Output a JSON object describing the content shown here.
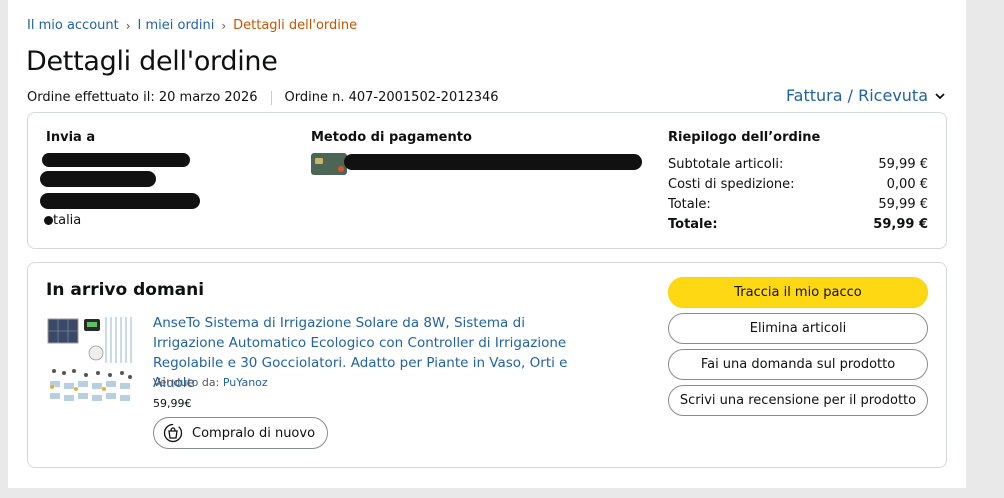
{
  "breadcrumb": {
    "account": "Il mio account",
    "orders": "I miei ordini",
    "current": "Dettagli dell'ordine",
    "separator": "›"
  },
  "page_title": "Dettagli dell'ordine",
  "order_meta": {
    "placed": "Ordine effettuato il: 20 marzo 2026",
    "number": "Ordine n. 407-2001502-2012346"
  },
  "invoice_label": "Fattura / Ricevuta",
  "shipping": {
    "title": "Invia a",
    "country": "talia"
  },
  "payment": {
    "title": "Metodo di pagamento"
  },
  "summary": {
    "title": "Riepilogo dell’ordine",
    "rows": [
      {
        "label": "Subtotale articoli:",
        "value": "59,99 €"
      },
      {
        "label": "Costi di spedizione:",
        "value": "0,00 €"
      },
      {
        "label": "Totale:",
        "value": "59,99 €"
      },
      {
        "label": "Totale:",
        "value": "59,99 €"
      }
    ]
  },
  "delivery": {
    "status": "In arrivo domani",
    "product_title": "AnseTo Sistema di Irrigazione Solare da 8W, Sistema di Irrigazione Automatico Ecologico con Controller di Irrigazione Regolabile e 30 Gocciolatori. Adatto per Piante in Vaso, Orti e Aiuole",
    "sold_by_label": "Venduto da:",
    "seller": "PuYanoz",
    "price": "59,99€",
    "buy_again": "Compralo di nuovo"
  },
  "actions": {
    "track": "Traccia il mio pacco",
    "remove": "Elimina articoli",
    "ask": "Fai una domanda sul prodotto",
    "review": "Scrivi una recensione per il prodotto"
  },
  "colors": {
    "link": "#2162a1",
    "breadcrumb_current": "#c45500",
    "primary_button": "#ffd814",
    "border": "#d5d9d9"
  },
  "icons": [
    "chevron-down-icon",
    "buy-again-icon",
    "credit-card-icon"
  ]
}
